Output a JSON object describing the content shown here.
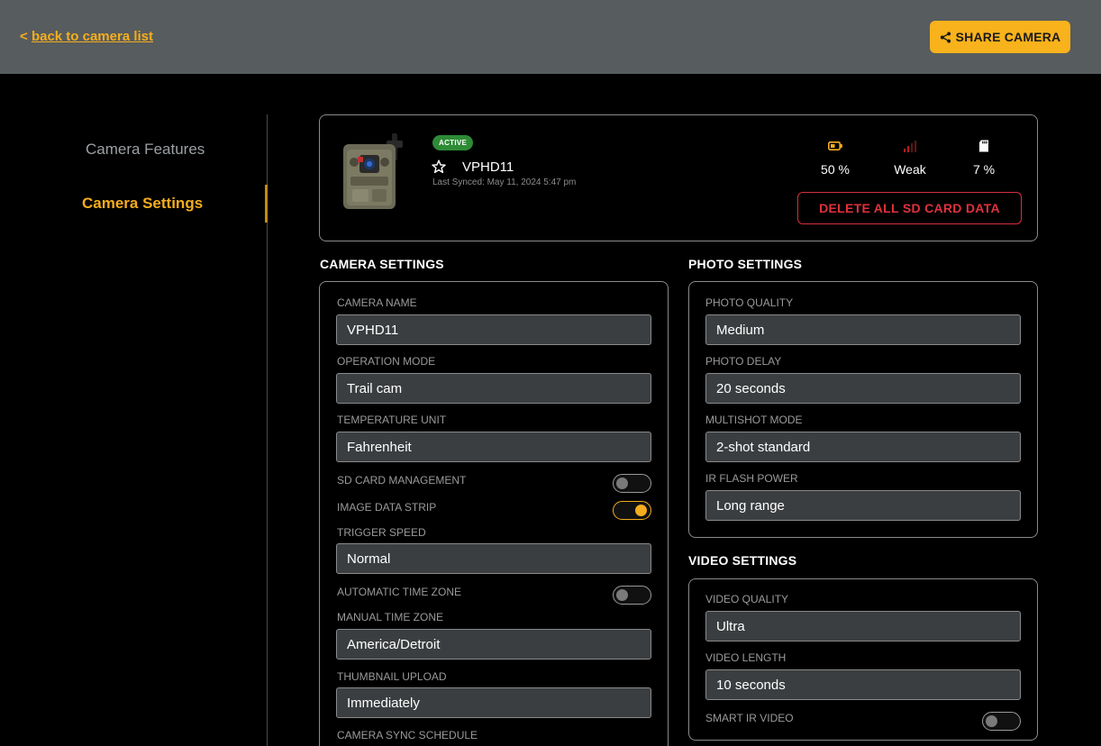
{
  "header": {
    "back_prefix": "<",
    "back_label": "back to camera list",
    "share_label": "SHARE CAMERA"
  },
  "sidebar": {
    "items": [
      {
        "label": "Camera Features"
      },
      {
        "label": "Camera Settings"
      }
    ]
  },
  "summary": {
    "status": "ACTIVE",
    "name": "VPHD11",
    "last_synced": "Last Synced: May 11, 2024 5:47 pm",
    "battery": "50 %",
    "signal": "Weak",
    "sd_card": "7 %",
    "delete_label": "DELETE ALL SD CARD DATA"
  },
  "camera_settings": {
    "title": "CAMERA SETTINGS",
    "camera_name_label": "CAMERA NAME",
    "camera_name": "VPHD11",
    "operation_mode_label": "OPERATION MODE",
    "operation_mode": "Trail cam",
    "temperature_unit_label": "TEMPERATURE UNIT",
    "temperature_unit": "Fahrenheit",
    "sd_card_management_label": "SD CARD MANAGEMENT",
    "image_data_strip_label": "IMAGE DATA STRIP",
    "trigger_speed_label": "TRIGGER SPEED",
    "trigger_speed": "Normal",
    "automatic_time_zone_label": "AUTOMATIC TIME ZONE",
    "manual_time_zone_label": "MANUAL TIME ZONE",
    "manual_time_zone": "America/Detroit",
    "thumbnail_upload_label": "THUMBNAIL UPLOAD",
    "thumbnail_upload": "Immediately",
    "sync_schedule_label": "CAMERA SYNC SCHEDULE"
  },
  "photo_settings": {
    "title": "PHOTO SETTINGS",
    "quality_label": "PHOTO QUALITY",
    "quality": "Medium",
    "delay_label": "PHOTO DELAY",
    "delay": "20 seconds",
    "multishot_label": "MULTISHOT MODE",
    "multishot": "2-shot standard",
    "ir_flash_label": "IR FLASH POWER",
    "ir_flash": "Long range"
  },
  "video_settings": {
    "title": "VIDEO SETTINGS",
    "quality_label": "VIDEO QUALITY",
    "quality": "Ultra",
    "length_label": "VIDEO LENGTH",
    "length": "10 seconds",
    "smart_ir_label": "SMART IR VIDEO"
  },
  "toggles": {
    "sd_card_management": false,
    "image_data_strip": true,
    "automatic_time_zone": false,
    "smart_ir_video": false
  },
  "colors": {
    "accent": "#f5ad1e",
    "danger": "#e0313d",
    "active_badge": "#2e8b36",
    "topbar": "#575c5e",
    "field_bg": "#3b3e40"
  }
}
